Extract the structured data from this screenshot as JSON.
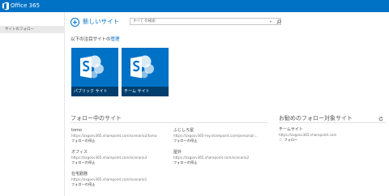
{
  "suite_bar": {
    "title": "Office 365",
    "brand_color": "#0072c6"
  },
  "left_nav": {
    "items": [
      {
        "label": "サイトのフォロー"
      }
    ]
  },
  "header": {
    "new_site_label": "新しいサイト",
    "search": {
      "scope_label": "すべて の検索",
      "dropdown_icon": "chevron-down-icon",
      "icon": "search-icon"
    }
  },
  "promoted": {
    "heading_prefix": "以下の注目サイトの",
    "heading_link": "管理",
    "tiles": [
      {
        "label": "パブリック サイト",
        "icon": "sharepoint-logo"
      },
      {
        "label": "チーム サイト",
        "icon": "sharepoint-logo"
      }
    ]
  },
  "followed": {
    "heading": "フォロー中のサイト",
    "sites": [
      {
        "name": "tomo",
        "url": "https://zxgosv365.sharepoint.com/scenario2/tomo",
        "action": "フォローの停止"
      },
      {
        "name": "ふじしろ屋",
        "url": "https://zxgosv365-my.sharepoint.com/personal/...",
        "action": "フォローの停止"
      },
      {
        "name": "オフィス",
        "url": "https://zxgosv365.sharepoint.com/scenario3",
        "action": "フォローの停止"
      },
      {
        "name": "屋外",
        "url": "https://zxgosv365.sharepoint.com/scenario2",
        "action": "フォローの停止"
      },
      {
        "name": "在宅勤務",
        "url": "https://zxgosv365.sharepoint.com/scenario1",
        "action": "フォローの停止"
      }
    ]
  },
  "suggested": {
    "heading": "お勧めのフォロー対象サイト",
    "refresh_icon": "refresh-icon",
    "sites": [
      {
        "name": "チームサイト",
        "url": "https://zxgosv365.sharepoint.com",
        "action": "フォロー",
        "icon": "star-icon"
      }
    ]
  }
}
